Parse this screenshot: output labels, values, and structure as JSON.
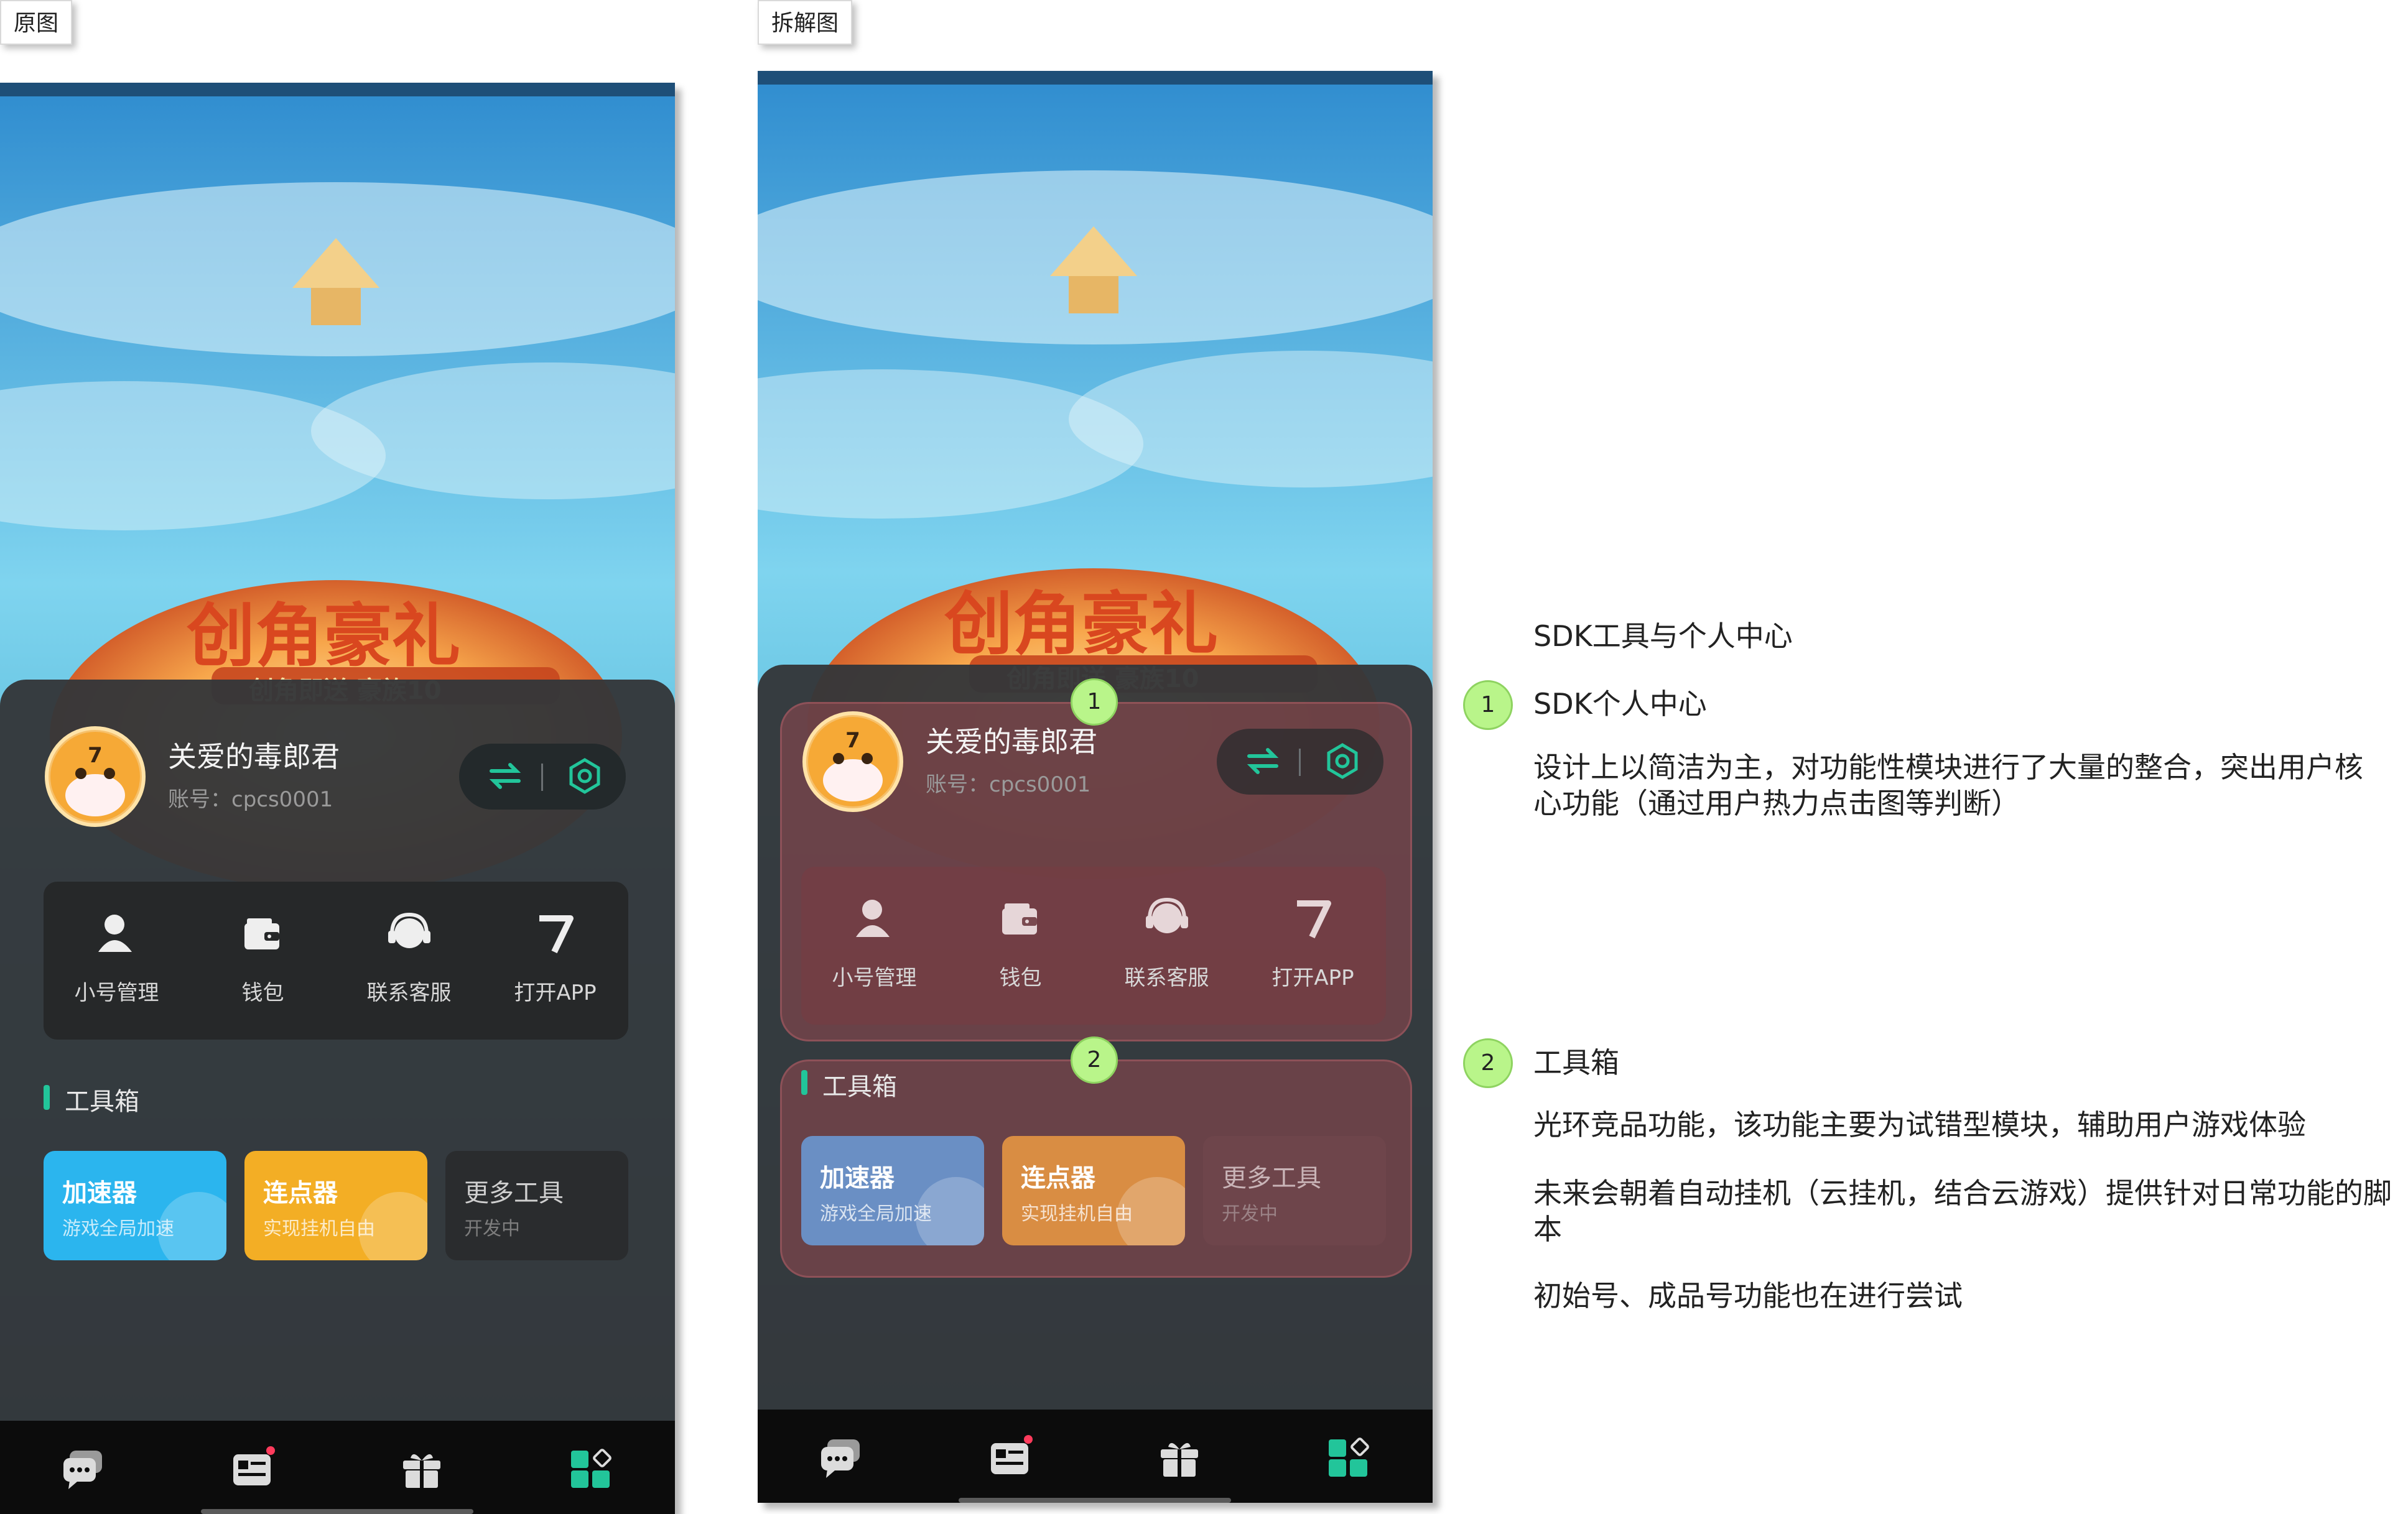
{
  "labels": {
    "original": "原图",
    "breakdown": "拆解图"
  },
  "banner": {
    "title": "创角豪礼",
    "subtitle": "创角即送 豪族10"
  },
  "profile": {
    "name": "关爱的毒郎君",
    "account": "账号：cpcs0001"
  },
  "quick_actions": [
    {
      "label": "小号管理",
      "icon": "user-icon"
    },
    {
      "label": "钱包",
      "icon": "wallet-icon"
    },
    {
      "label": "联系客服",
      "icon": "headset-icon"
    },
    {
      "label": "打开APP",
      "icon": "app-7-icon"
    }
  ],
  "toolbox": {
    "title": "工具箱",
    "tools": [
      {
        "title": "加速器",
        "subtitle": "游戏全局加速",
        "color": "#2bb5ee"
      },
      {
        "title": "连点器",
        "subtitle": "实现挂机自由",
        "color": "#f3ae25"
      },
      {
        "title": "更多工具",
        "subtitle": "开发中",
        "color": "#2a2c2e"
      }
    ]
  },
  "tabbar": [
    "chat-icon",
    "news-icon",
    "gift-icon",
    "apps-icon"
  ],
  "markers": [
    "1",
    "2"
  ],
  "annotations": {
    "heading": "SDK工具与个人中心",
    "items": [
      {
        "num": "1",
        "title": "SDK个人中心",
        "desc": "设计上以简洁为主，对功能性模块进行了大量的整合，突出用户核心功能（通过用户热力点击图等判断）"
      },
      {
        "num": "2",
        "title": "工具箱",
        "p1": "光环竞品功能，该功能主要为试错型模块，辅助用户游戏体验",
        "p2": "未来会朝着自动挂机（云挂机，结合云游戏）提供针对日常功能的脚本",
        "p3": "初始号、成品号功能也在进行尝试"
      }
    ]
  },
  "colors": {
    "accent": "#22c59a",
    "marker": "#b9f58a",
    "badge": "#ff3b5c"
  }
}
